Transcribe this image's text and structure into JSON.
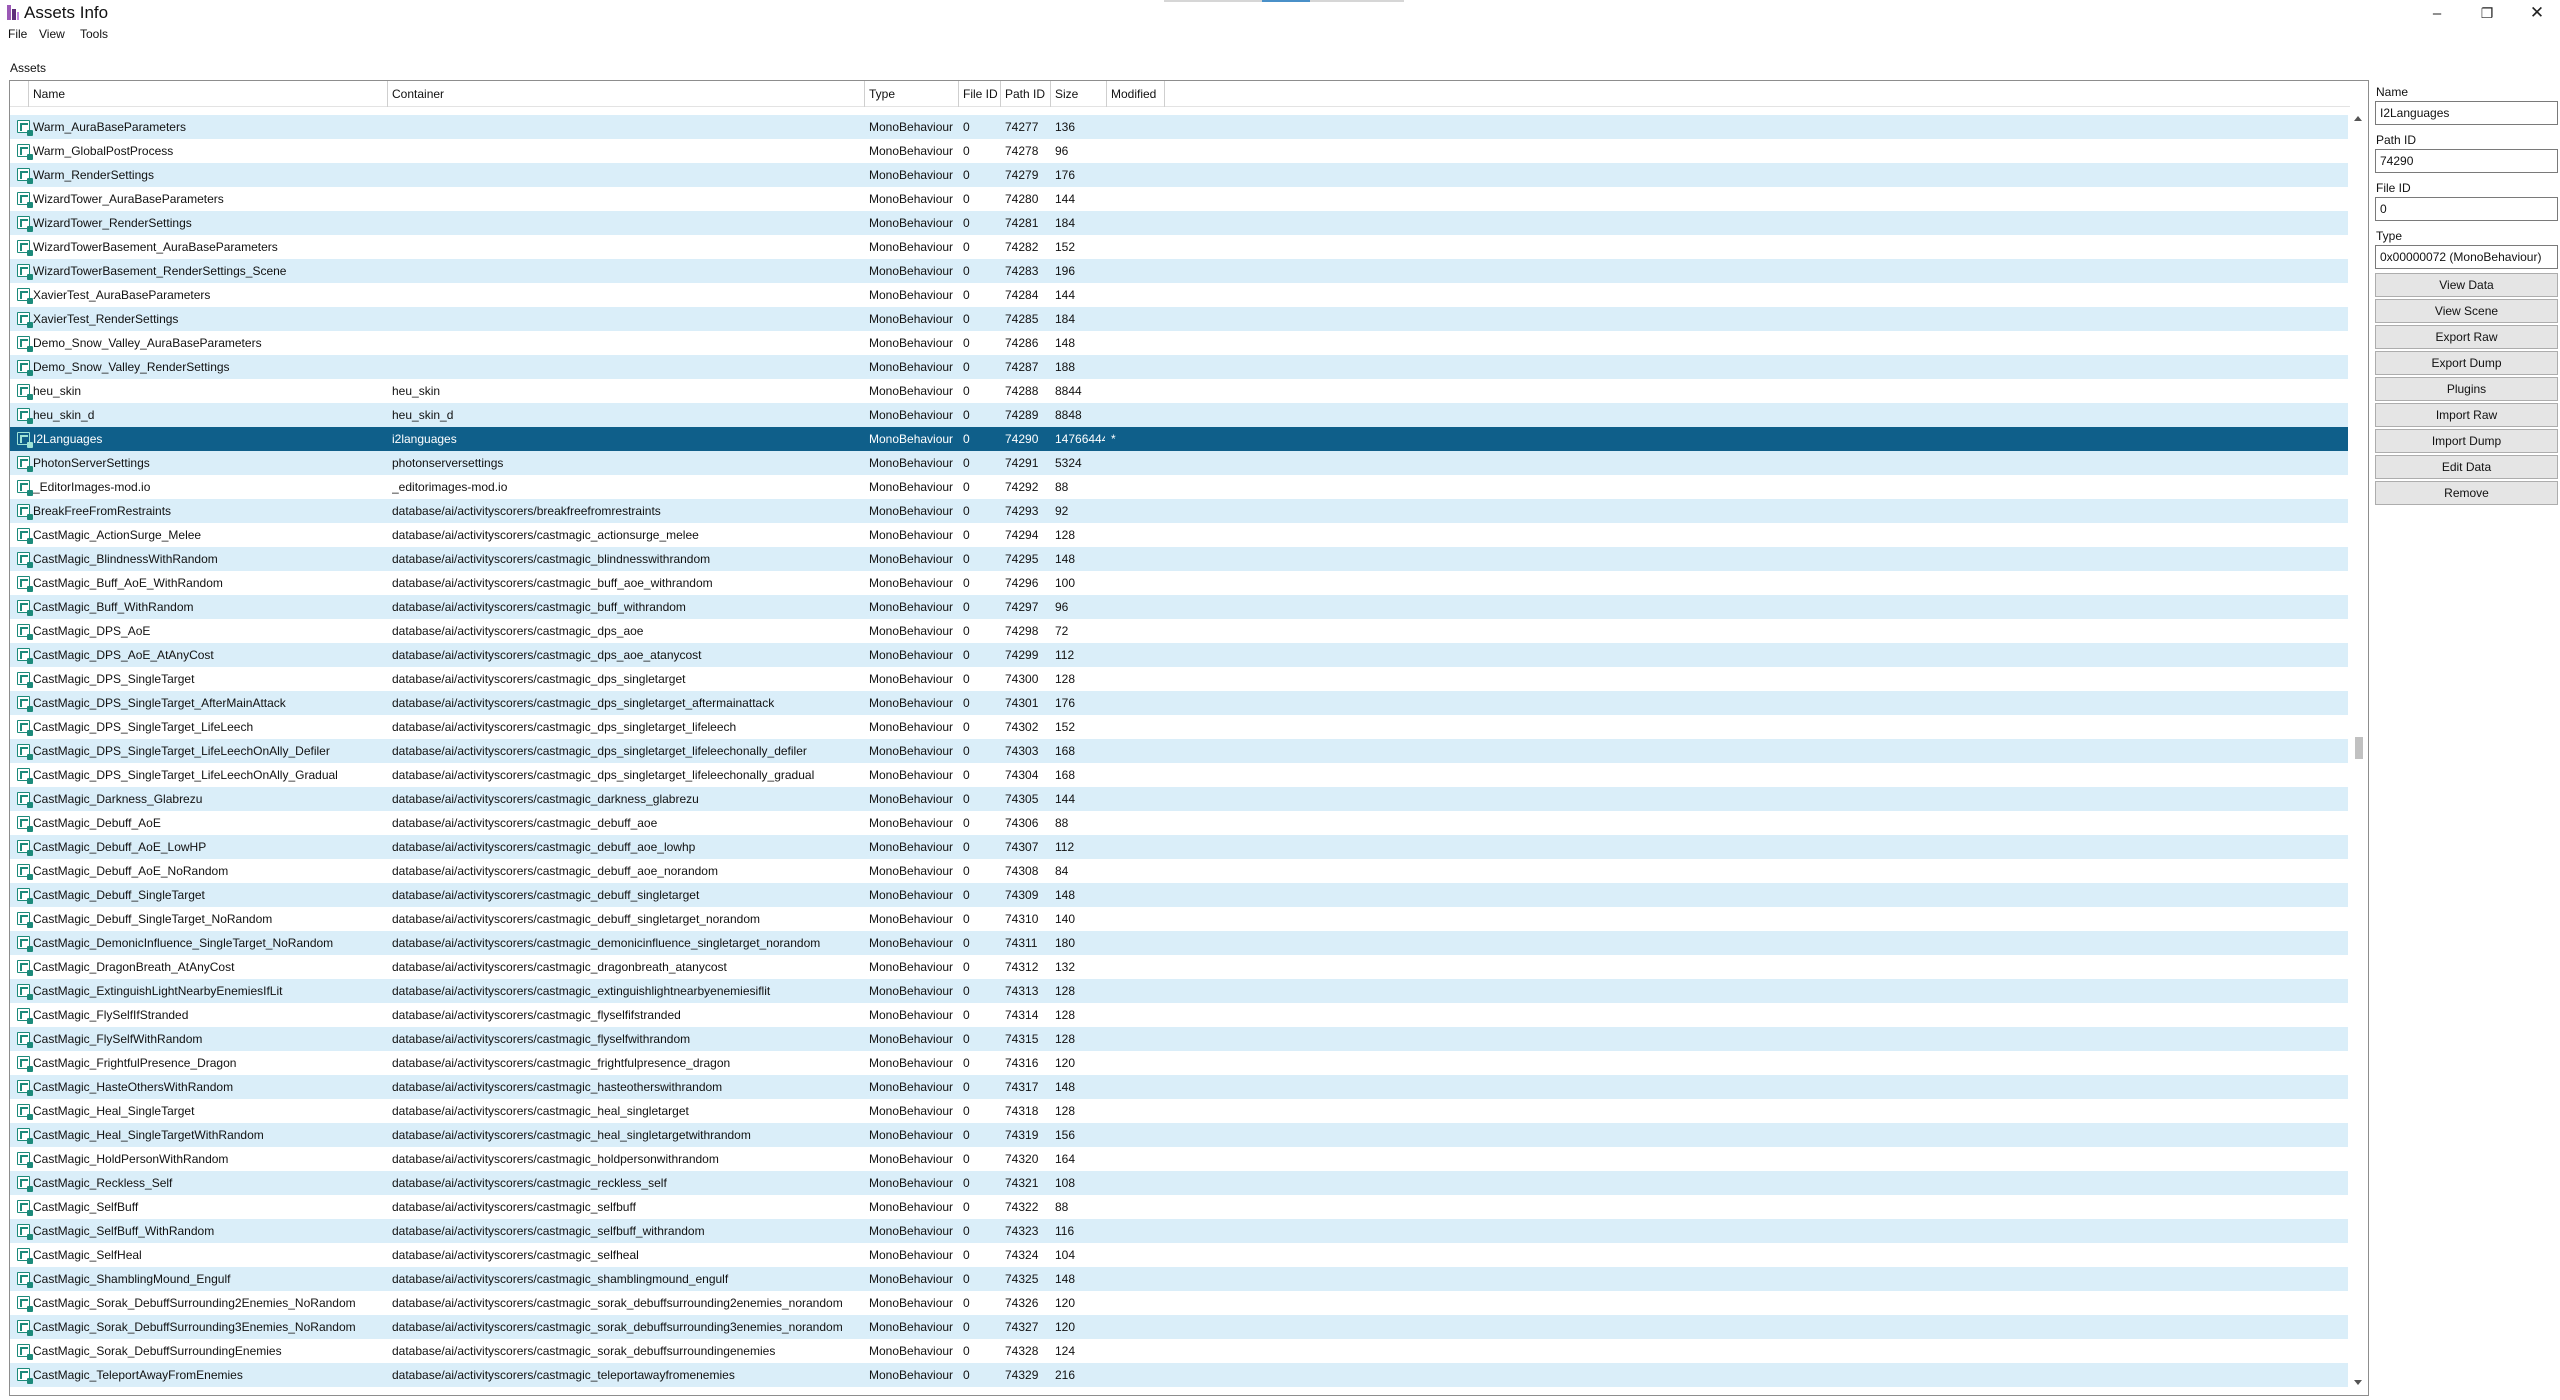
{
  "window": {
    "title": "Assets Info",
    "controls": {
      "minimize": "–",
      "maximize": "❐",
      "close": "✕"
    },
    "app_icon": "asset-bundle-icon"
  },
  "menu": [
    "File",
    "View",
    "Tools"
  ],
  "assets_label": "Assets",
  "columns": [
    "Name",
    "Container",
    "Type",
    "File ID",
    "Path ID",
    "Size",
    "Modified"
  ],
  "row_icon": "monobehaviour-asset-icon",
  "selected_row": 13,
  "rows": [
    {
      "name": "Warm_AuraBaseParameters",
      "container": "",
      "type": "MonoBehaviour",
      "file_id": "0",
      "path_id": "74277",
      "size": "136",
      "modified": ""
    },
    {
      "name": "Warm_GlobalPostProcess",
      "container": "",
      "type": "MonoBehaviour",
      "file_id": "0",
      "path_id": "74278",
      "size": "96",
      "modified": ""
    },
    {
      "name": "Warm_RenderSettings",
      "container": "",
      "type": "MonoBehaviour",
      "file_id": "0",
      "path_id": "74279",
      "size": "176",
      "modified": ""
    },
    {
      "name": "WizardTower_AuraBaseParameters",
      "container": "",
      "type": "MonoBehaviour",
      "file_id": "0",
      "path_id": "74280",
      "size": "144",
      "modified": ""
    },
    {
      "name": "WizardTower_RenderSettings",
      "container": "",
      "type": "MonoBehaviour",
      "file_id": "0",
      "path_id": "74281",
      "size": "184",
      "modified": ""
    },
    {
      "name": "WizardTowerBasement_AuraBaseParameters",
      "container": "",
      "type": "MonoBehaviour",
      "file_id": "0",
      "path_id": "74282",
      "size": "152",
      "modified": ""
    },
    {
      "name": "WizardTowerBasement_RenderSettings_Scene",
      "container": "",
      "type": "MonoBehaviour",
      "file_id": "0",
      "path_id": "74283",
      "size": "196",
      "modified": ""
    },
    {
      "name": "XavierTest_AuraBaseParameters",
      "container": "",
      "type": "MonoBehaviour",
      "file_id": "0",
      "path_id": "74284",
      "size": "144",
      "modified": ""
    },
    {
      "name": "XavierTest_RenderSettings",
      "container": "",
      "type": "MonoBehaviour",
      "file_id": "0",
      "path_id": "74285",
      "size": "184",
      "modified": ""
    },
    {
      "name": "Demo_Snow_Valley_AuraBaseParameters",
      "container": "",
      "type": "MonoBehaviour",
      "file_id": "0",
      "path_id": "74286",
      "size": "148",
      "modified": ""
    },
    {
      "name": "Demo_Snow_Valley_RenderSettings",
      "container": "",
      "type": "MonoBehaviour",
      "file_id": "0",
      "path_id": "74287",
      "size": "188",
      "modified": ""
    },
    {
      "name": "heu_skin",
      "container": "heu_skin",
      "type": "MonoBehaviour",
      "file_id": "0",
      "path_id": "74288",
      "size": "8844",
      "modified": ""
    },
    {
      "name": "heu_skin_d",
      "container": "heu_skin_d",
      "type": "MonoBehaviour",
      "file_id": "0",
      "path_id": "74289",
      "size": "8848",
      "modified": ""
    },
    {
      "name": "I2Languages",
      "container": "i2languages",
      "type": "MonoBehaviour",
      "file_id": "0",
      "path_id": "74290",
      "size": "14766444",
      "modified": "*"
    },
    {
      "name": "PhotonServerSettings",
      "container": "photonserversettings",
      "type": "MonoBehaviour",
      "file_id": "0",
      "path_id": "74291",
      "size": "5324",
      "modified": ""
    },
    {
      "name": "_EditorImages-mod.io",
      "container": "_editorimages-mod.io",
      "type": "MonoBehaviour",
      "file_id": "0",
      "path_id": "74292",
      "size": "88",
      "modified": ""
    },
    {
      "name": "BreakFreeFromRestraints",
      "container": "database/ai/activityscorers/breakfreefromrestraints",
      "type": "MonoBehaviour",
      "file_id": "0",
      "path_id": "74293",
      "size": "92",
      "modified": ""
    },
    {
      "name": "CastMagic_ActionSurge_Melee",
      "container": "database/ai/activityscorers/castmagic_actionsurge_melee",
      "type": "MonoBehaviour",
      "file_id": "0",
      "path_id": "74294",
      "size": "128",
      "modified": ""
    },
    {
      "name": "CastMagic_BlindnessWithRandom",
      "container": "database/ai/activityscorers/castmagic_blindnesswithrandom",
      "type": "MonoBehaviour",
      "file_id": "0",
      "path_id": "74295",
      "size": "148",
      "modified": ""
    },
    {
      "name": "CastMagic_Buff_AoE_WithRandom",
      "container": "database/ai/activityscorers/castmagic_buff_aoe_withrandom",
      "type": "MonoBehaviour",
      "file_id": "0",
      "path_id": "74296",
      "size": "100",
      "modified": ""
    },
    {
      "name": "CastMagic_Buff_WithRandom",
      "container": "database/ai/activityscorers/castmagic_buff_withrandom",
      "type": "MonoBehaviour",
      "file_id": "0",
      "path_id": "74297",
      "size": "96",
      "modified": ""
    },
    {
      "name": "CastMagic_DPS_AoE",
      "container": "database/ai/activityscorers/castmagic_dps_aoe",
      "type": "MonoBehaviour",
      "file_id": "0",
      "path_id": "74298",
      "size": "72",
      "modified": ""
    },
    {
      "name": "CastMagic_DPS_AoE_AtAnyCost",
      "container": "database/ai/activityscorers/castmagic_dps_aoe_atanycost",
      "type": "MonoBehaviour",
      "file_id": "0",
      "path_id": "74299",
      "size": "112",
      "modified": ""
    },
    {
      "name": "CastMagic_DPS_SingleTarget",
      "container": "database/ai/activityscorers/castmagic_dps_singletarget",
      "type": "MonoBehaviour",
      "file_id": "0",
      "path_id": "74300",
      "size": "128",
      "modified": ""
    },
    {
      "name": "CastMagic_DPS_SingleTarget_AfterMainAttack",
      "container": "database/ai/activityscorers/castmagic_dps_singletarget_aftermainattack",
      "type": "MonoBehaviour",
      "file_id": "0",
      "path_id": "74301",
      "size": "176",
      "modified": ""
    },
    {
      "name": "CastMagic_DPS_SingleTarget_LifeLeech",
      "container": "database/ai/activityscorers/castmagic_dps_singletarget_lifeleech",
      "type": "MonoBehaviour",
      "file_id": "0",
      "path_id": "74302",
      "size": "152",
      "modified": ""
    },
    {
      "name": "CastMagic_DPS_SingleTarget_LifeLeechOnAlly_Defiler",
      "container": "database/ai/activityscorers/castmagic_dps_singletarget_lifeleechonally_defiler",
      "type": "MonoBehaviour",
      "file_id": "0",
      "path_id": "74303",
      "size": "168",
      "modified": ""
    },
    {
      "name": "CastMagic_DPS_SingleTarget_LifeLeechOnAlly_Gradual",
      "container": "database/ai/activityscorers/castmagic_dps_singletarget_lifeleechonally_gradual",
      "type": "MonoBehaviour",
      "file_id": "0",
      "path_id": "74304",
      "size": "168",
      "modified": ""
    },
    {
      "name": "CastMagic_Darkness_Glabrezu",
      "container": "database/ai/activityscorers/castmagic_darkness_glabrezu",
      "type": "MonoBehaviour",
      "file_id": "0",
      "path_id": "74305",
      "size": "144",
      "modified": ""
    },
    {
      "name": "CastMagic_Debuff_AoE",
      "container": "database/ai/activityscorers/castmagic_debuff_aoe",
      "type": "MonoBehaviour",
      "file_id": "0",
      "path_id": "74306",
      "size": "88",
      "modified": ""
    },
    {
      "name": "CastMagic_Debuff_AoE_LowHP",
      "container": "database/ai/activityscorers/castmagic_debuff_aoe_lowhp",
      "type": "MonoBehaviour",
      "file_id": "0",
      "path_id": "74307",
      "size": "112",
      "modified": ""
    },
    {
      "name": "CastMagic_Debuff_AoE_NoRandom",
      "container": "database/ai/activityscorers/castmagic_debuff_aoe_norandom",
      "type": "MonoBehaviour",
      "file_id": "0",
      "path_id": "74308",
      "size": "84",
      "modified": ""
    },
    {
      "name": "CastMagic_Debuff_SingleTarget",
      "container": "database/ai/activityscorers/castmagic_debuff_singletarget",
      "type": "MonoBehaviour",
      "file_id": "0",
      "path_id": "74309",
      "size": "148",
      "modified": ""
    },
    {
      "name": "CastMagic_Debuff_SingleTarget_NoRandom",
      "container": "database/ai/activityscorers/castmagic_debuff_singletarget_norandom",
      "type": "MonoBehaviour",
      "file_id": "0",
      "path_id": "74310",
      "size": "140",
      "modified": ""
    },
    {
      "name": "CastMagic_DemonicInfluence_SingleTarget_NoRandom",
      "container": "database/ai/activityscorers/castmagic_demonicinfluence_singletarget_norandom",
      "type": "MonoBehaviour",
      "file_id": "0",
      "path_id": "74311",
      "size": "180",
      "modified": ""
    },
    {
      "name": "CastMagic_DragonBreath_AtAnyCost",
      "container": "database/ai/activityscorers/castmagic_dragonbreath_atanycost",
      "type": "MonoBehaviour",
      "file_id": "0",
      "path_id": "74312",
      "size": "132",
      "modified": ""
    },
    {
      "name": "CastMagic_ExtinguishLightNearbyEnemiesIfLit",
      "container": "database/ai/activityscorers/castmagic_extinguishlightnearbyenemiesiflit",
      "type": "MonoBehaviour",
      "file_id": "0",
      "path_id": "74313",
      "size": "128",
      "modified": ""
    },
    {
      "name": "CastMagic_FlySelfIfStranded",
      "container": "database/ai/activityscorers/castmagic_flyselfifstranded",
      "type": "MonoBehaviour",
      "file_id": "0",
      "path_id": "74314",
      "size": "128",
      "modified": ""
    },
    {
      "name": "CastMagic_FlySelfWithRandom",
      "container": "database/ai/activityscorers/castmagic_flyselfwithrandom",
      "type": "MonoBehaviour",
      "file_id": "0",
      "path_id": "74315",
      "size": "128",
      "modified": ""
    },
    {
      "name": "CastMagic_FrightfulPresence_Dragon",
      "container": "database/ai/activityscorers/castmagic_frightfulpresence_dragon",
      "type": "MonoBehaviour",
      "file_id": "0",
      "path_id": "74316",
      "size": "120",
      "modified": ""
    },
    {
      "name": "CastMagic_HasteOthersWithRandom",
      "container": "database/ai/activityscorers/castmagic_hasteotherswithrandom",
      "type": "MonoBehaviour",
      "file_id": "0",
      "path_id": "74317",
      "size": "148",
      "modified": ""
    },
    {
      "name": "CastMagic_Heal_SingleTarget",
      "container": "database/ai/activityscorers/castmagic_heal_singletarget",
      "type": "MonoBehaviour",
      "file_id": "0",
      "path_id": "74318",
      "size": "128",
      "modified": ""
    },
    {
      "name": "CastMagic_Heal_SingleTargetWithRandom",
      "container": "database/ai/activityscorers/castmagic_heal_singletargetwithrandom",
      "type": "MonoBehaviour",
      "file_id": "0",
      "path_id": "74319",
      "size": "156",
      "modified": ""
    },
    {
      "name": "CastMagic_HoldPersonWithRandom",
      "container": "database/ai/activityscorers/castmagic_holdpersonwithrandom",
      "type": "MonoBehaviour",
      "file_id": "0",
      "path_id": "74320",
      "size": "164",
      "modified": ""
    },
    {
      "name": "CastMagic_Reckless_Self",
      "container": "database/ai/activityscorers/castmagic_reckless_self",
      "type": "MonoBehaviour",
      "file_id": "0",
      "path_id": "74321",
      "size": "108",
      "modified": ""
    },
    {
      "name": "CastMagic_SelfBuff",
      "container": "database/ai/activityscorers/castmagic_selfbuff",
      "type": "MonoBehaviour",
      "file_id": "0",
      "path_id": "74322",
      "size": "88",
      "modified": ""
    },
    {
      "name": "CastMagic_SelfBuff_WithRandom",
      "container": "database/ai/activityscorers/castmagic_selfbuff_withrandom",
      "type": "MonoBehaviour",
      "file_id": "0",
      "path_id": "74323",
      "size": "116",
      "modified": ""
    },
    {
      "name": "CastMagic_SelfHeal",
      "container": "database/ai/activityscorers/castmagic_selfheal",
      "type": "MonoBehaviour",
      "file_id": "0",
      "path_id": "74324",
      "size": "104",
      "modified": ""
    },
    {
      "name": "CastMagic_ShamblingMound_Engulf",
      "container": "database/ai/activityscorers/castmagic_shamblingmound_engulf",
      "type": "MonoBehaviour",
      "file_id": "0",
      "path_id": "74325",
      "size": "148",
      "modified": ""
    },
    {
      "name": "CastMagic_Sorak_DebuffSurrounding2Enemies_NoRandom",
      "container": "database/ai/activityscorers/castmagic_sorak_debuffsurrounding2enemies_norandom",
      "type": "MonoBehaviour",
      "file_id": "0",
      "path_id": "74326",
      "size": "120",
      "modified": ""
    },
    {
      "name": "CastMagic_Sorak_DebuffSurrounding3Enemies_NoRandom",
      "container": "database/ai/activityscorers/castmagic_sorak_debuffsurrounding3enemies_norandom",
      "type": "MonoBehaviour",
      "file_id": "0",
      "path_id": "74327",
      "size": "120",
      "modified": ""
    },
    {
      "name": "CastMagic_Sorak_DebuffSurroundingEnemies",
      "container": "database/ai/activityscorers/castmagic_sorak_debuffsurroundingenemies",
      "type": "MonoBehaviour",
      "file_id": "0",
      "path_id": "74328",
      "size": "124",
      "modified": ""
    },
    {
      "name": "CastMagic_TeleportAwayFromEnemies",
      "container": "database/ai/activityscorers/castmagic_teleportawayfromenemies",
      "type": "MonoBehaviour",
      "file_id": "0",
      "path_id": "74329",
      "size": "216",
      "modified": ""
    }
  ],
  "panel": {
    "name_label": "Name",
    "name_value": "I2Languages",
    "path_id_label": "Path ID",
    "path_id_value": "74290",
    "file_id_label": "File ID",
    "file_id_value": "0",
    "type_label": "Type",
    "type_value": "0x00000072 (MonoBehaviour)",
    "buttons": [
      "View Data",
      "View Scene",
      "Export Raw",
      "Export Dump",
      "Plugins",
      "Import Raw",
      "Import Dump",
      "Edit Data",
      "Remove"
    ]
  },
  "scroll": {
    "position_fraction": 0.5
  }
}
